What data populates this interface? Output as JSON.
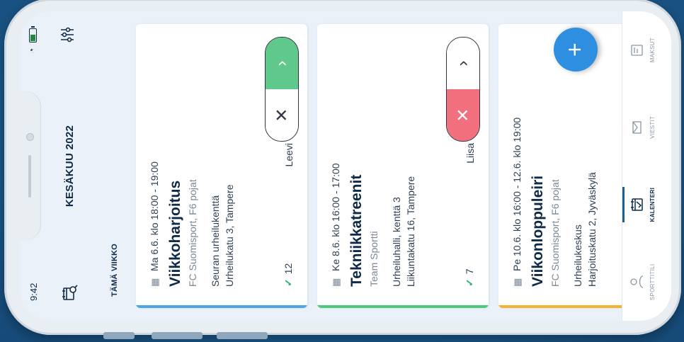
{
  "status": {
    "time": "9:42",
    "wifi_icon": "wifi-icon",
    "battery_icon": "battery-icon"
  },
  "header": {
    "title": "KESÄKUU 2022",
    "left_icon": "calendar-search-icon",
    "right_icon": "filter-sliders-icon"
  },
  "section": {
    "label": "TÄMÄ VIIKKO"
  },
  "events": [
    {
      "date": "Ma 6.6. klo 18:00 - 19:00",
      "title": "Viikkoharjoitus",
      "team": "FC Suomisport, F6 pojat",
      "location": "Seuran urheilukenttä",
      "address": "Urheilukatu 3, Tampere",
      "attendees": "12",
      "person": "Leevi",
      "stripe_color": "#4aa8e8",
      "selected": "yes"
    },
    {
      "date": "Ke 8.6. klo 16:00 - 17:00",
      "title": "Tekniikkatreenit",
      "team": "Team Sportti",
      "location": "Urheiluhalli, kenttä 3",
      "address": "Liikuntakatu 16, Tampere",
      "attendees": "7",
      "person": "Liisa",
      "stripe_color": "#4cc97a",
      "selected": "no"
    },
    {
      "date": "Pe 10.6. klo 16:00 - 12.6. klo 19:00",
      "title": "Viikonloppuleiri",
      "team": "FC Suomisport, F6 pojat",
      "location": "Urheilukeskus",
      "address": "Harjoituskatu 2, Jyväskylä",
      "stripe_color": "#f2b233"
    }
  ],
  "tabs": [
    {
      "label": "SPORTTITILI",
      "icon": "profile-icon"
    },
    {
      "label": "KALENTERI",
      "icon": "calendar-icon",
      "active": true
    },
    {
      "label": "VIESTIT",
      "icon": "envelope-icon"
    },
    {
      "label": "MAKSUT",
      "icon": "payment-icon"
    }
  ],
  "fab": {
    "icon": "plus-icon",
    "label": "+"
  },
  "colors": {
    "accent": "#2e8ee0",
    "yes": "#5fc98c",
    "no": "#f2707e",
    "navy": "#0e2a47"
  }
}
